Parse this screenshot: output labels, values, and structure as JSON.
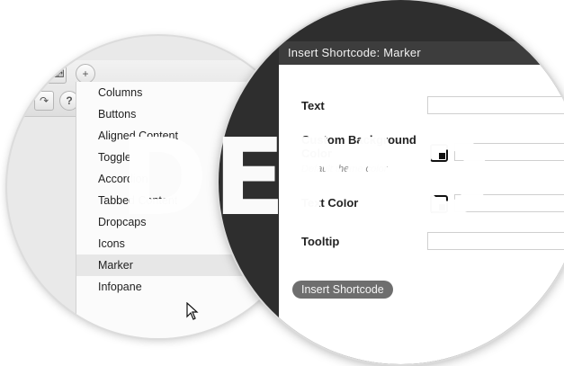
{
  "editor": {
    "menu_items": [
      {
        "label": "Columns"
      },
      {
        "label": "Buttons"
      },
      {
        "label": "Aligned Content"
      },
      {
        "label": "Toggle"
      },
      {
        "label": "Accordion"
      },
      {
        "label": "Tabbed Content"
      },
      {
        "label": "Dropcaps"
      },
      {
        "label": "Icons"
      },
      {
        "label": "Marker"
      },
      {
        "label": "Infopane"
      }
    ],
    "hovered_item": "Marker"
  },
  "dialog": {
    "title": "Insert Shortcode: Marker",
    "fields": {
      "text_label": "Text",
      "bg_color_label": "Custom Background Color",
      "bg_color_hint": "Default theme color",
      "text_color_label": "Text Color",
      "tooltip_label": "Tooltip"
    },
    "insert_button": "Insert Shortcode"
  },
  "watermark": "DEMO"
}
